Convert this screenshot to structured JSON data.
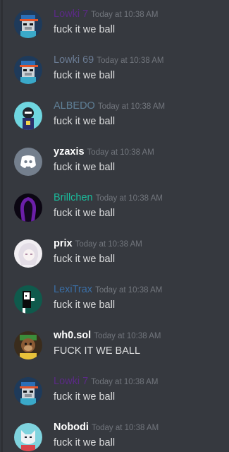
{
  "messages": [
    {
      "author": "Lowki 7",
      "timestamp": "Today at 10:38 AM",
      "text": "fuck it we ball",
      "name_color": "#5b2a86",
      "avatar_icon": "pixel-gorilla-cap-avatar"
    },
    {
      "author": "Lowki 69",
      "timestamp": "Today at 10:38 AM",
      "text": "fuck it we ball",
      "name_color": "#6a7b93",
      "avatar_icon": "pixel-gorilla-cap-avatar"
    },
    {
      "author": "ALBEDO",
      "timestamp": "Today at 10:38 AM",
      "text": "fuck it we ball",
      "name_color": "#5f7f96",
      "avatar_icon": "character-avatar"
    },
    {
      "author": "yzaxis",
      "timestamp": "Today at 10:38 AM",
      "text": "fuck it we ball",
      "name_color": "#ffffff",
      "avatar_icon": "discord-default-avatar"
    },
    {
      "author": "Brillchen",
      "timestamp": "Today at 10:38 AM",
      "text": "fuck it we ball",
      "name_color": "#1abc9c",
      "avatar_icon": "purple-hooded-figure-avatar"
    },
    {
      "author": "prix",
      "timestamp": "Today at 10:38 AM",
      "text": "fuck it we ball",
      "name_color": "#ffffff",
      "avatar_icon": "anime-girl-avatar"
    },
    {
      "author": "LexiTrax",
      "timestamp": "Today at 10:38 AM",
      "text": "fuck it we ball",
      "name_color": "#3a6ea5",
      "avatar_icon": "pixel-figure-avatar"
    },
    {
      "author": "wh0.sol",
      "timestamp": "Today at 10:38 AM",
      "text": "FUCK IT WE BALL",
      "name_color": "#ffffff",
      "avatar_icon": "ape-avatar"
    },
    {
      "author": "Lowki 7",
      "timestamp": "Today at 10:38 AM",
      "text": "fuck it we ball",
      "name_color": "#5b2a86",
      "avatar_icon": "pixel-gorilla-cap-avatar"
    },
    {
      "author": "Nobodi",
      "timestamp": "Today at 10:38 AM",
      "text": "fuck it we ball",
      "name_color": "#ffffff",
      "avatar_icon": "wolf-avatar"
    }
  ]
}
